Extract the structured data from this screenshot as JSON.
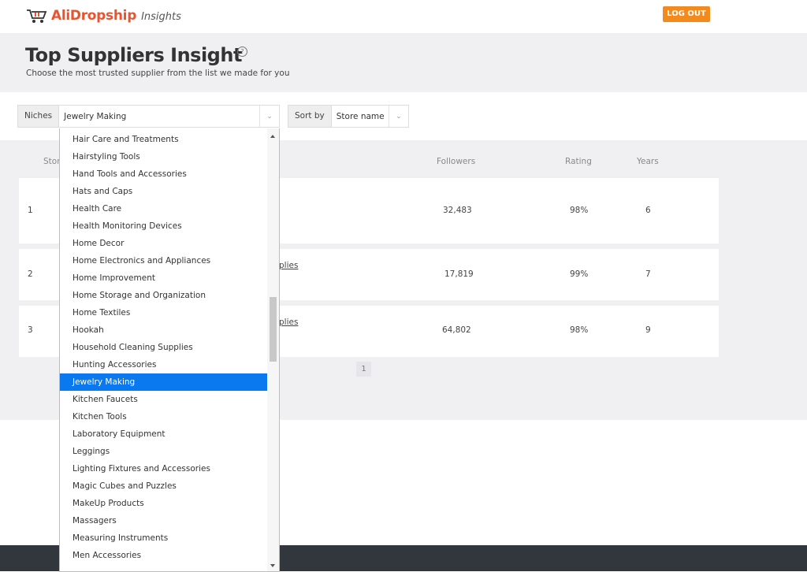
{
  "header": {
    "brand": "AliDropship",
    "brand_sub": "Insights",
    "logout_label": "LOG OUT"
  },
  "hero": {
    "title": "Top Suppliers Insight",
    "help_icon": "question-circle-icon",
    "subtitle": "Choose the most trusted supplier from the list we made for you"
  },
  "filters": {
    "niches_label": "Niches",
    "niches_value": "Jewelry Making",
    "sort_label": "Sort by",
    "sort_value": "Store name"
  },
  "table": {
    "columns": {
      "store": "Stor",
      "followers": "Followers",
      "rating": "Rating",
      "years": "Years"
    },
    "rows": [
      {
        "rank": "1",
        "link": "",
        "followers": "32,483",
        "rating": "98%",
        "years": "6"
      },
      {
        "rank": "2",
        "link": "plies",
        "followers": "17,819",
        "rating": "99%",
        "years": "7"
      },
      {
        "rank": "3",
        "link": "plies",
        "followers": "64,802",
        "rating": "98%",
        "years": "9"
      }
    ],
    "page": "1"
  },
  "dropdown": {
    "selected": "Jewelry Making",
    "items": [
      "Hair Care and Treatments",
      "Hairstyling Tools",
      "Hand Tools and Accessories",
      "Hats and Caps",
      "Health Care",
      "Health Monitoring Devices",
      "Home Decor",
      "Home Electronics and Appliances",
      "Home Improvement",
      "Home Storage and Organization",
      "Home Textiles",
      "Hookah",
      "Household Cleaning Supplies",
      "Hunting Accessories",
      "Jewelry Making",
      "Kitchen Faucets",
      "Kitchen Tools",
      "Laboratory Equipment",
      "Leggings",
      "Lighting Fixtures and Accessories",
      "Magic Cubes and Puzzles",
      "MakeUp Products",
      "Massagers",
      "Measuring Instruments",
      "Men Accessories"
    ]
  },
  "colors": {
    "brand": "#e8542f",
    "logout": "#f28a1e",
    "selected": "#0a78ef",
    "footer": "#32363d"
  }
}
